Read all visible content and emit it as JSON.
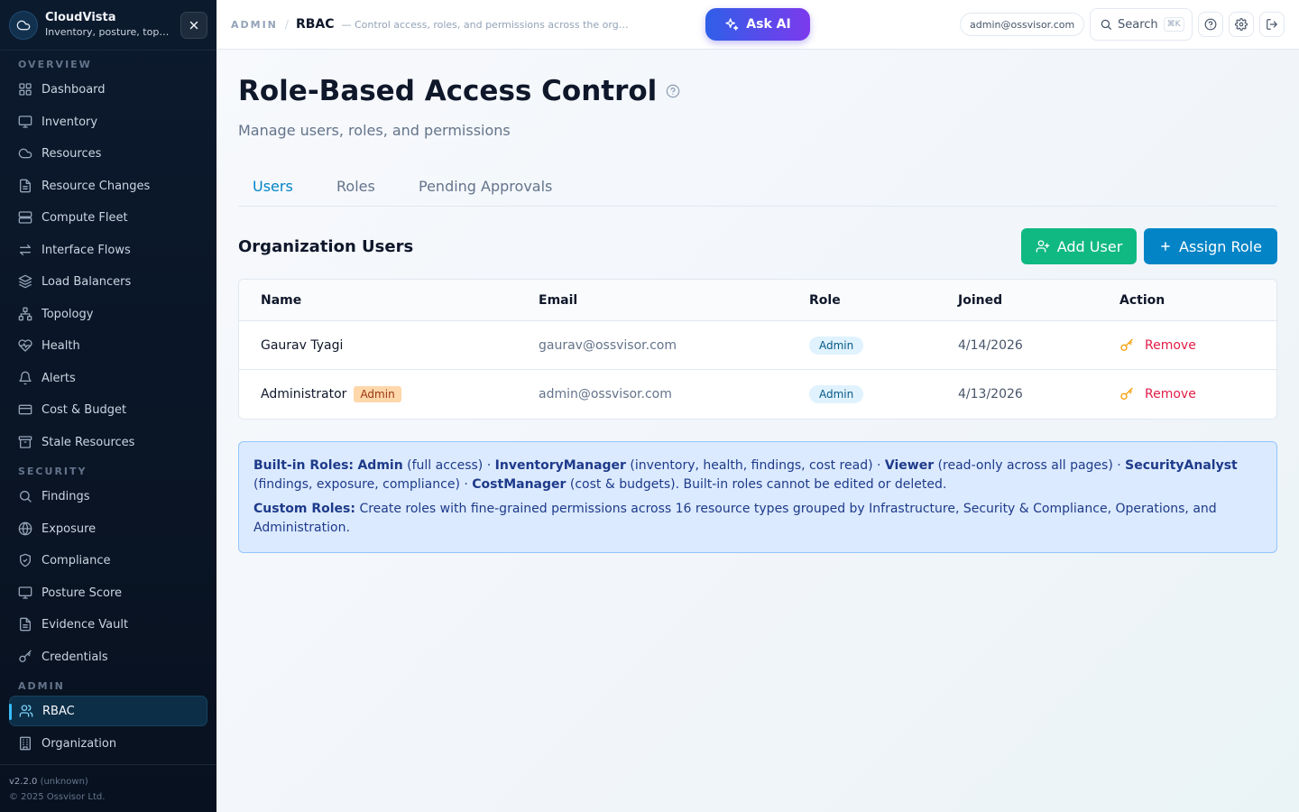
{
  "app": {
    "name": "CloudVista",
    "tagline": "Inventory, posture, topology & compliance"
  },
  "sidebar": {
    "sections": {
      "overview": "OVERVIEW",
      "security": "SECURITY",
      "admin": "ADMIN"
    },
    "items": [
      {
        "label": "Dashboard",
        "icon": "grid-icon"
      },
      {
        "label": "Inventory",
        "icon": "monitor-icon"
      },
      {
        "label": "Resources",
        "icon": "cloud-icon"
      },
      {
        "label": "Resource Changes",
        "icon": "file-icon"
      },
      {
        "label": "Compute Fleet",
        "icon": "server-icon"
      },
      {
        "label": "Interface Flows",
        "icon": "arrows-icon"
      },
      {
        "label": "Load Balancers",
        "icon": "layers-icon"
      },
      {
        "label": "Topology",
        "icon": "network-icon"
      },
      {
        "label": "Health",
        "icon": "heart-pulse-icon"
      },
      {
        "label": "Alerts",
        "icon": "bell-icon"
      },
      {
        "label": "Cost & Budget",
        "icon": "wallet-icon"
      },
      {
        "label": "Stale Resources",
        "icon": "archive-icon"
      },
      {
        "label": "Findings",
        "icon": "search-icon"
      },
      {
        "label": "Exposure",
        "icon": "globe-icon"
      },
      {
        "label": "Compliance",
        "icon": "shield-icon"
      },
      {
        "label": "Posture Score",
        "icon": "monitor-icon"
      },
      {
        "label": "Evidence Vault",
        "icon": "file-icon"
      },
      {
        "label": "Credentials",
        "icon": "key-icon"
      },
      {
        "label": "RBAC",
        "icon": "users-icon",
        "active": true
      },
      {
        "label": "Organization",
        "icon": "building-icon"
      }
    ],
    "footer": {
      "version": "v2.2.0",
      "build": "(unknown)",
      "copyright": "© 2025 Ossvisor Ltd."
    }
  },
  "topbar": {
    "breadcrumb_section": "ADMIN",
    "breadcrumb_sep": "/",
    "breadcrumb_current": "RBAC",
    "breadcrumb_desc": "— Control access, roles, and permissions across the organization",
    "ask_ai": "Ask AI",
    "user_email": "admin@ossvisor.com",
    "search_label": "Search",
    "search_shortcut": "⌘K"
  },
  "page": {
    "title": "Role-Based Access Control",
    "subtitle": "Manage users, roles, and permissions",
    "tabs": [
      {
        "label": "Users",
        "active": true
      },
      {
        "label": "Roles"
      },
      {
        "label": "Pending Approvals"
      }
    ],
    "section_title": "Organization Users",
    "add_user_label": "Add User",
    "assign_role_label": "Assign Role"
  },
  "table": {
    "columns": [
      "Name",
      "Email",
      "Role",
      "Joined",
      "Action"
    ],
    "rows": [
      {
        "name": "Gaurav Tyagi",
        "badge": "",
        "email": "gaurav@ossvisor.com",
        "role": "Admin",
        "joined": "4/14/2026",
        "action": "Remove"
      },
      {
        "name": "Administrator",
        "badge": "Admin",
        "email": "admin@ossvisor.com",
        "role": "Admin",
        "joined": "4/13/2026",
        "action": "Remove"
      }
    ]
  },
  "info": {
    "builtin_heading": "Built-in Roles:",
    "roles": [
      {
        "name": "Admin",
        "desc": "(full access)"
      },
      {
        "name": "InventoryManager",
        "desc": "(inventory, health, findings, cost read)"
      },
      {
        "name": "Viewer",
        "desc": "(read-only across all pages)"
      },
      {
        "name": "SecurityAnalyst",
        "desc": "(findings, exposure, compliance)"
      },
      {
        "name": "CostManager",
        "desc": "(cost & budgets)."
      }
    ],
    "separator": " · ",
    "builtin_note": "Built-in roles cannot be edited or deleted.",
    "custom_heading": "Custom Roles:",
    "custom_text": "Create roles with fine-grained permissions across 16 resource types grouped by Infrastructure, Security & Compliance, Operations, and Administration."
  },
  "colors": {
    "accent": "#0284c7",
    "success": "#10b981",
    "danger": "#e11d48",
    "sidebar_bg": "#0c1a2e",
    "ai_gradient_start": "#2f5fe8",
    "ai_gradient_end": "#7c3aed"
  }
}
